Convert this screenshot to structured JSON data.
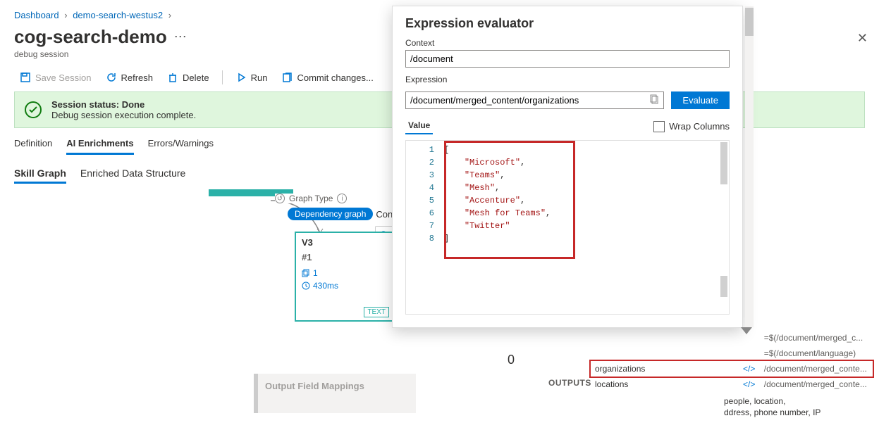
{
  "breadcrumb": {
    "dashboard": "Dashboard",
    "svc": "demo-search-westus2"
  },
  "title": "cog-search-demo",
  "subtitle": "debug session",
  "toolbar": {
    "save": "Save Session",
    "refresh": "Refresh",
    "delete": "Delete",
    "run": "Run",
    "commit": "Commit changes..."
  },
  "status": {
    "line1": "Session status: Done",
    "line2": "Debug session execution complete."
  },
  "tabs": {
    "def": "Definition",
    "ai": "AI Enrichments",
    "err": "Errors/Warnings"
  },
  "subtabs": {
    "sg": "Skill Graph",
    "eds": "Enriched Data Structure"
  },
  "graphtype": {
    "label": "Graph Type",
    "selected": "Dependency graph",
    "other": "Con"
  },
  "node": {
    "title": "V3",
    "sub": "#1",
    "count": "1",
    "time": "430ms",
    "tag": "TEXT"
  },
  "ofm": "Output Field Mappings",
  "rightinfo": {
    "l1": "people, location,",
    "l2": "ddress, phone number, IP"
  },
  "io": {
    "zero": "0",
    "outputs": "OUTPUTS",
    "rows": [
      {
        "name": "",
        "path": "=$(/document/merged_c..."
      },
      {
        "name": "",
        "path": "=$(/document/language)"
      },
      {
        "name": "organizations",
        "path": "/document/merged_conte..."
      },
      {
        "name": "locations",
        "path": "/document/merged_conte..."
      }
    ]
  },
  "panel": {
    "title": "Expression evaluator",
    "ctxlabel": "Context",
    "ctxval": "/document",
    "exprlabel": "Expression",
    "exprval": "/document/merged_content/organizations",
    "evalbtn": "Evaluate",
    "valuelabel": "Value",
    "wrap": "Wrap Columns",
    "lines": [
      "1",
      "2",
      "3",
      "4",
      "5",
      "6",
      "7",
      "8"
    ],
    "values": [
      "Microsoft",
      "Teams",
      "Mesh",
      "Accenture",
      "Mesh for Teams",
      "Twitter"
    ]
  },
  "chart_data": {
    "type": "table",
    "title": "Expression evaluator result for /document/merged_content/organizations",
    "values": [
      "Microsoft",
      "Teams",
      "Mesh",
      "Accenture",
      "Mesh for Teams",
      "Twitter"
    ]
  }
}
